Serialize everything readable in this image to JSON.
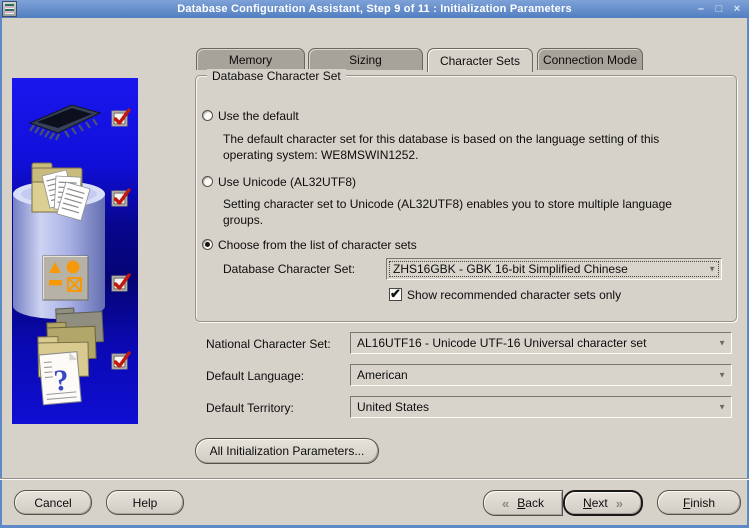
{
  "window": {
    "title": "Database Configuration Assistant, Step 9 of 11 : Initialization Parameters",
    "controls": {
      "minimize": "–",
      "maximize": "□",
      "close": "×"
    }
  },
  "tabs": [
    {
      "label": "Memory"
    },
    {
      "label": "Sizing"
    },
    {
      "label": "Character Sets"
    },
    {
      "label": "Connection Mode"
    }
  ],
  "active_tab": "Character Sets",
  "charset_group": {
    "title": "Database Character Set",
    "option_default": {
      "label": "Use the default",
      "selected": false,
      "description": "The default character set for this database is based on the language setting of this operating system: WE8MSWIN1252."
    },
    "option_unicode": {
      "label": "Use Unicode (AL32UTF8)",
      "selected": false,
      "description": "Setting character set to Unicode (AL32UTF8) enables you to store multiple language groups."
    },
    "option_list": {
      "label": "Choose from the list of character sets",
      "selected": true
    },
    "db_charset": {
      "label": "Database Character Set:",
      "value": "ZHS16GBK - GBK 16-bit Simplified Chinese"
    },
    "recommended": {
      "label": "Show recommended character sets only",
      "checked": true
    }
  },
  "fields": {
    "national_charset": {
      "label": "National Character Set:",
      "value": "AL16UTF16 - Unicode UTF-16 Universal character set"
    },
    "default_language": {
      "label": "Default Language:",
      "value": "American"
    },
    "default_territory": {
      "label": "Default Territory:",
      "value": "United States"
    }
  },
  "buttons": {
    "all_init_params": "All Initialization Parameters...",
    "cancel": "Cancel",
    "help": "Help",
    "back": "Back",
    "next": "Next",
    "finish": "Finish"
  },
  "icons": {
    "back_chevron": "«",
    "next_chevron": "»",
    "dropdown_arrow": "▼",
    "checkmark": "✔"
  },
  "colors": {
    "titlebar_blue": "#5d89c6",
    "panel_gray": "#d6d2ca",
    "tab_inactive": "#a7a39b",
    "art_blue": "#0f0ed2",
    "check_red": "#c2180e",
    "shape_orange": "#f49a0a"
  }
}
